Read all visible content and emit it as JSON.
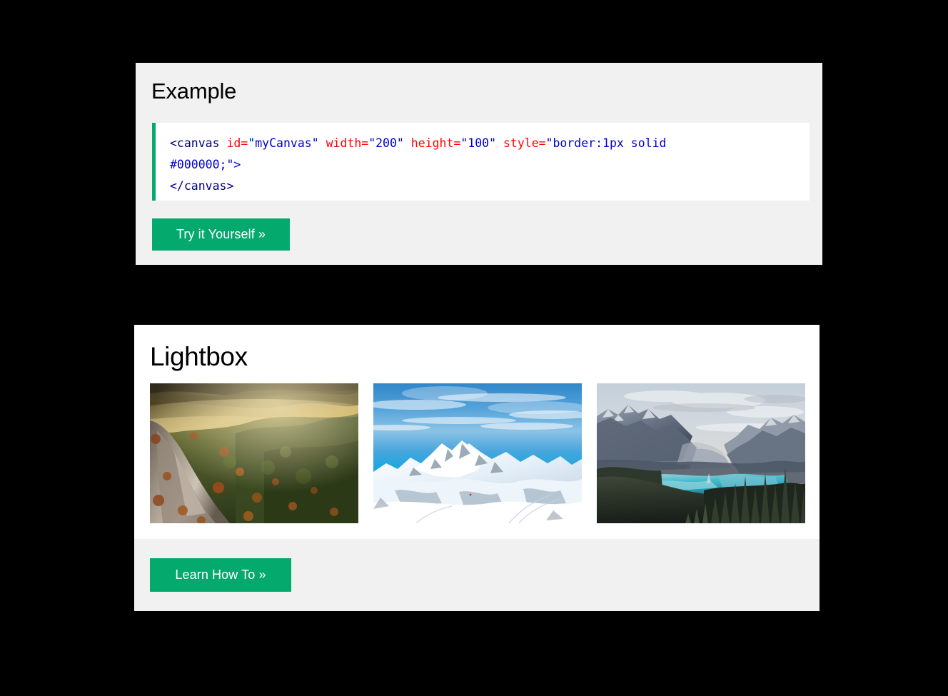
{
  "page": {
    "background_color": "#000000",
    "accent_green": "#04AA6D",
    "panel_gray": "#f1f1f1",
    "panel_white": "#ffffff"
  },
  "example_panel": {
    "title": "Example",
    "code": {
      "full_text": "<canvas id=\"myCanvas\" width=\"200\" height=\"100\" style=\"border:1px solid #000000;\">\n</canvas>",
      "tokens": {
        "open_tag": "<canvas",
        "attr_id": "id",
        "val_id": "\"myCanvas\"",
        "attr_width": "width",
        "val_width": "\"200\"",
        "attr_height": "height",
        "val_height": "\"100\"",
        "attr_style": "style",
        "val_style_part1": "\"border:1px solid",
        "val_style_part2": "#000000;\">",
        "close_tag": "</canvas>",
        "equals": "="
      },
      "colors": {
        "tag": "#000080",
        "attribute": "#ff0000",
        "value": "#0000cd"
      }
    },
    "try_button_label": "Try it Yourself »"
  },
  "lightbox_panel": {
    "title": "Lightbox",
    "thumbnails": [
      {
        "name": "autumn-mountain-valley",
        "alt": "Golden sunlit autumn forest valley with rocky cliff"
      },
      {
        "name": "snowy-alpine-peaks",
        "alt": "Snow covered mountain peaks under bright blue sky"
      },
      {
        "name": "turquoise-mountain-lake",
        "alt": "Turquoise glacial lake among mountains at dusk with pine trees"
      }
    ],
    "learn_button_label": "Learn How To »"
  }
}
